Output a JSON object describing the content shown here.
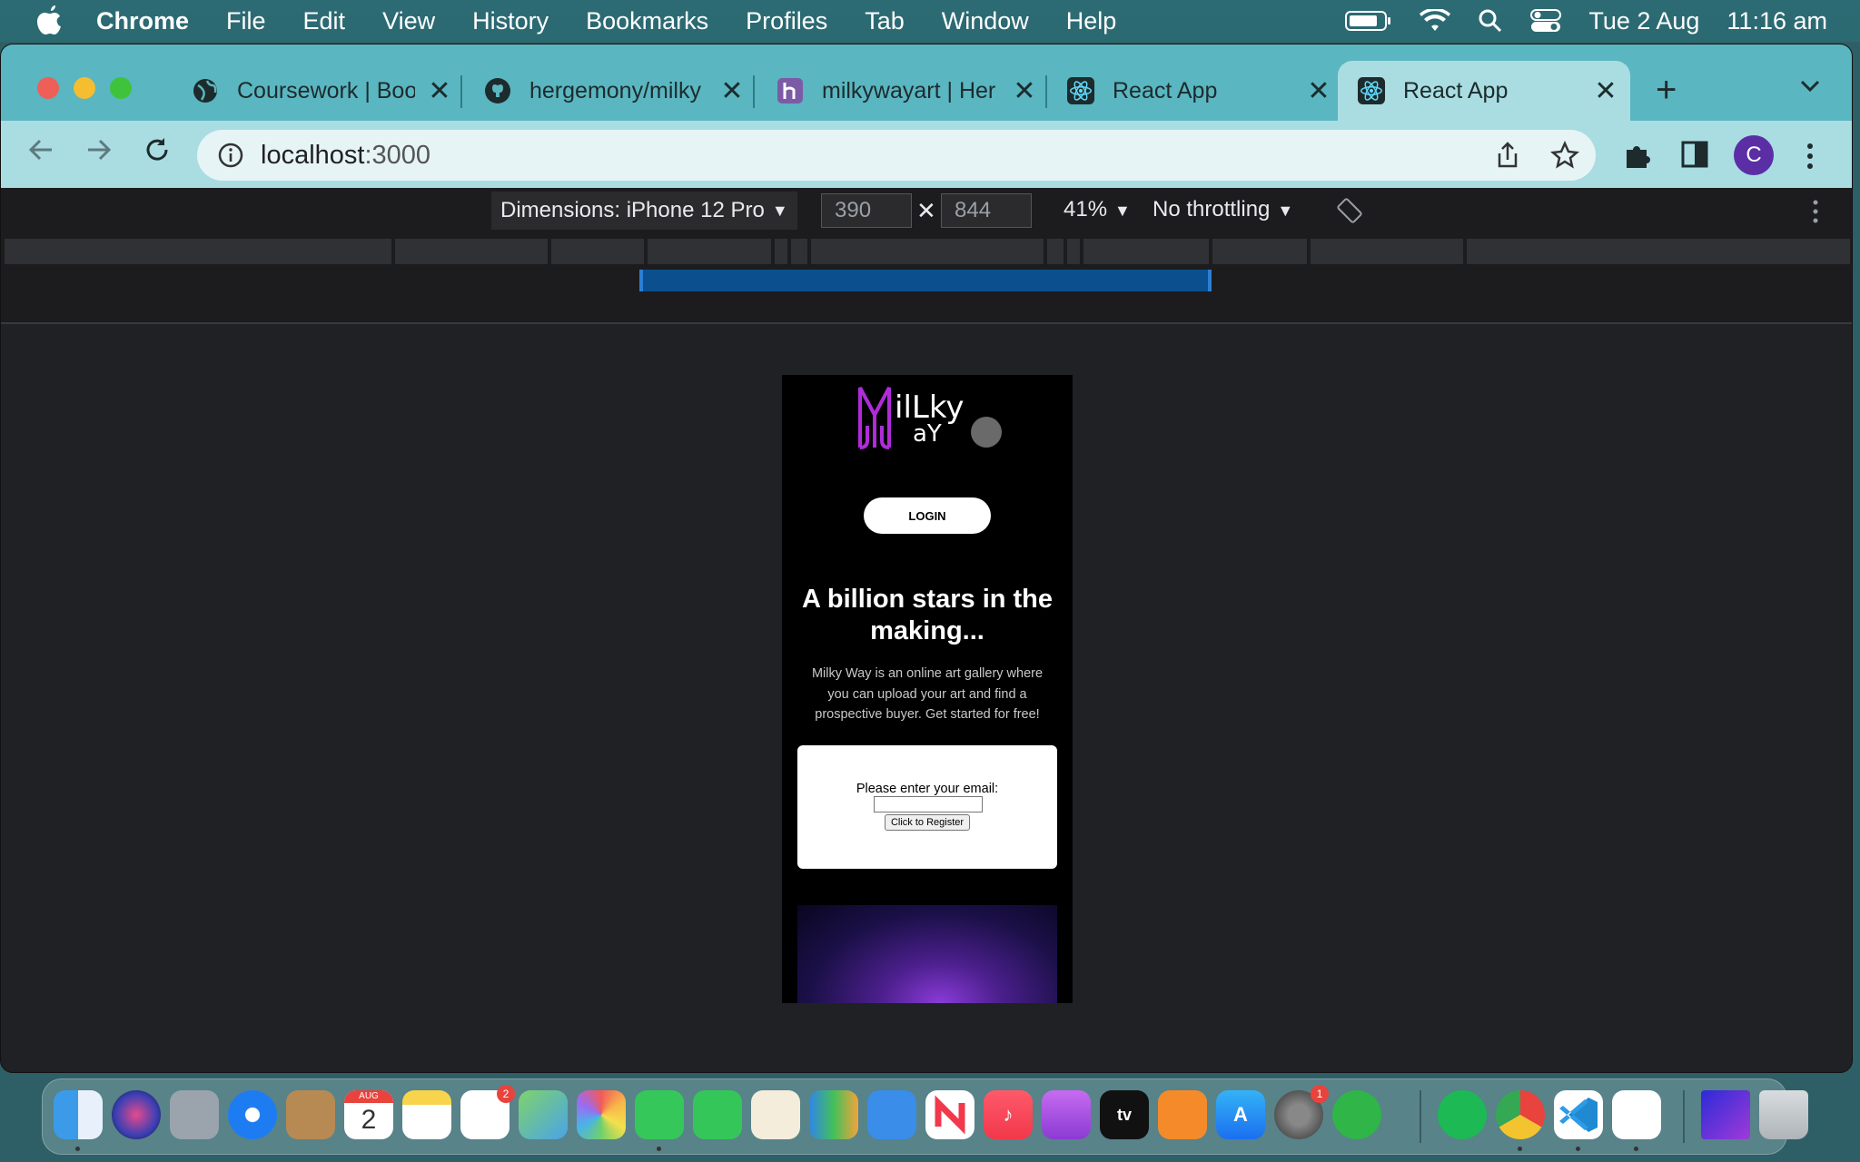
{
  "menubar": {
    "app": "Chrome",
    "items": [
      "File",
      "Edit",
      "View",
      "History",
      "Bookmarks",
      "Profiles",
      "Tab",
      "Window",
      "Help"
    ],
    "date": "Tue 2 Aug",
    "time": "11:16 am"
  },
  "tabs": [
    {
      "title": "Coursework | Boo",
      "icon": "globe-icon"
    },
    {
      "title": "hergemony/milky",
      "icon": "github-icon"
    },
    {
      "title": "milkywayart | Her",
      "icon": "heroku-icon"
    },
    {
      "title": "React App",
      "icon": "react-icon"
    },
    {
      "title": "React App",
      "icon": "react-icon",
      "active": true
    }
  ],
  "toolbar": {
    "url_host": "localhost",
    "url_port": ":3000",
    "profile_initial": "C"
  },
  "devtools": {
    "dimensions_label": "Dimensions: iPhone 12 Pro",
    "width": "390",
    "height": "844",
    "zoom": "41%",
    "throttling": "No throttling"
  },
  "page": {
    "logo_line1": "ilLky",
    "logo_line2": "aY",
    "login_label": "LOGIN",
    "headline": "A billion stars in the making...",
    "description": "Milky Way is an online art gallery where you can upload your art and find a prospective buyer. Get started for free!",
    "email_label": "Please enter your email:",
    "register_label": "Click to Register"
  },
  "dock": {
    "calendar_month": "AUG",
    "calendar_day": "2",
    "reminders_badge": "2",
    "settings_badge": "1",
    "tv_label": "tv"
  },
  "colors": {
    "menubar": "#2c6a72",
    "tabstrip": "#5ab6c0",
    "toolbar": "#a9dde2",
    "logo_purple": "#b02bd9",
    "profile": "#5b2ea6"
  }
}
